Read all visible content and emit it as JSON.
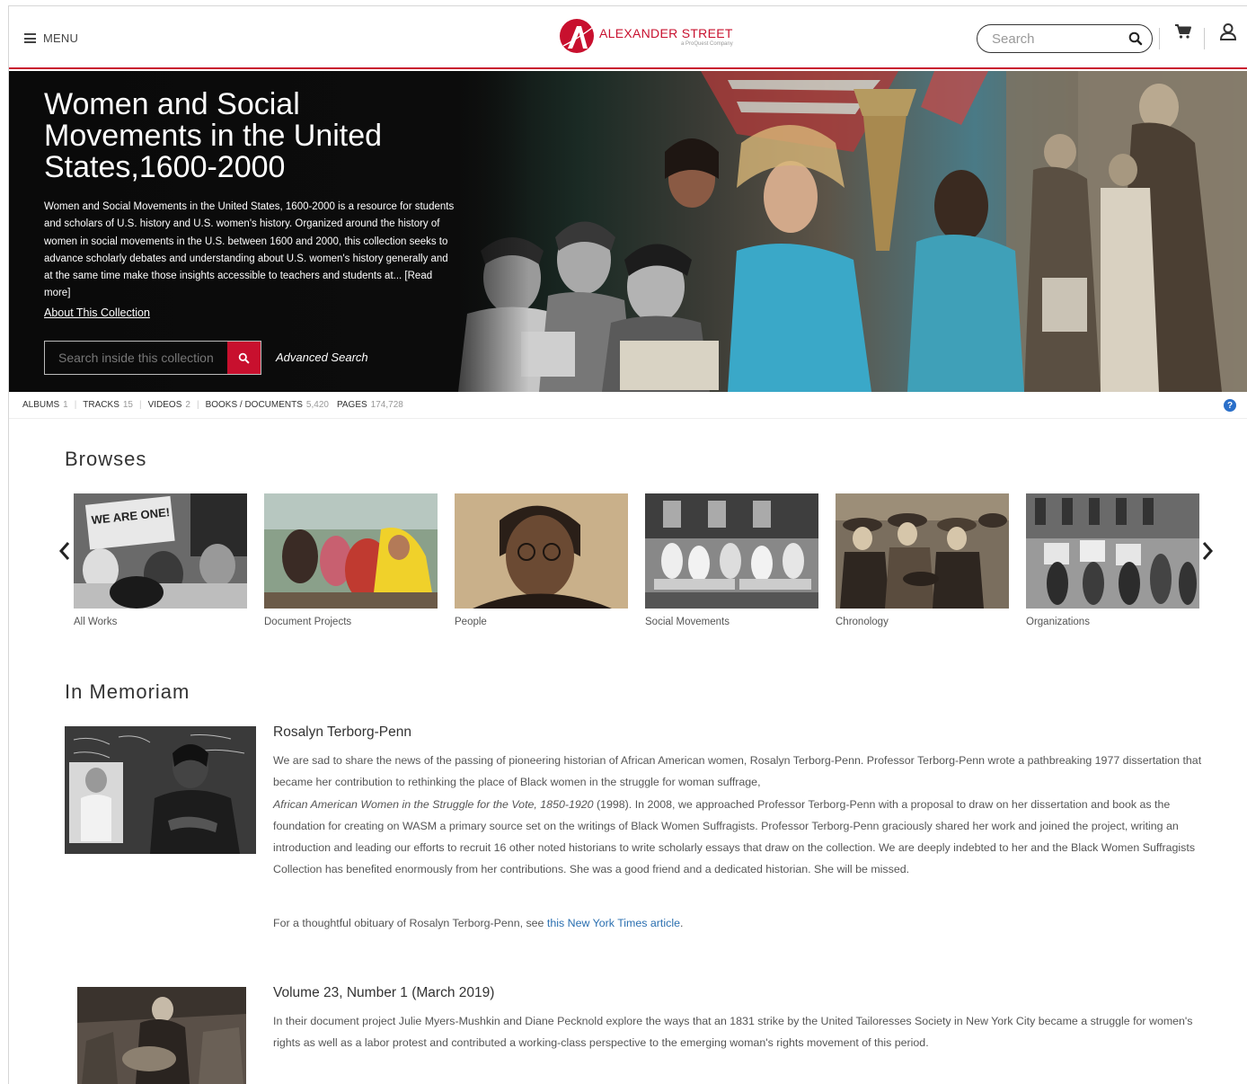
{
  "header": {
    "menu_label": "MENU",
    "logo_name": "ALEXANDER STREET",
    "logo_sub": "a ProQuest Company",
    "search_placeholder": "Search"
  },
  "hero": {
    "title": "Women and Social Movements in the United States,1600-2000",
    "description": "Women and Social Movements in the United States, 1600-2000 is a resource for students and scholars of U.S. history and U.S. women's history. Organized around the history of women in social movements in the U.S. between 1600 and 2000, this collection seeks to advance scholarly debates and understanding about U.S. women's history generally and at the same time make those insights accessible to teachers and students at... [Read more]",
    "about_link": "About This Collection",
    "collection_search_placeholder": "Search inside this collection",
    "advanced_search": "Advanced Search"
  },
  "stats": [
    {
      "label": "ALBUMS",
      "value": "1"
    },
    {
      "label": "TRACKS",
      "value": "15"
    },
    {
      "label": "VIDEOS",
      "value": "2"
    },
    {
      "label": "BOOKS / DOCUMENTS",
      "value": "5,420"
    },
    {
      "label": "PAGES",
      "value": "174,728"
    }
  ],
  "help_label": "?",
  "browses": {
    "title": "Browses",
    "items": [
      {
        "label": "All Works",
        "sign_text": "WE ARE ONE!"
      },
      {
        "label": "Document Projects"
      },
      {
        "label": "People"
      },
      {
        "label": "Social Movements"
      },
      {
        "label": "Chronology"
      },
      {
        "label": "Organizations"
      }
    ]
  },
  "memoriam": {
    "title": "In Memoriam",
    "entries": [
      {
        "title": "Rosalyn Terborg-Penn",
        "p1_a": "We are sad to share the news of the passing of pioneering historian of African American women, Rosalyn Terborg-Penn. Professor Terborg-Penn wrote a pathbreaking 1977 dissertation that became her contribution to rethinking the place of Black women in the struggle for woman suffrage,",
        "p1_italic": "African American Women in the Struggle for the Vote, 1850-1920",
        "p1_b": " (1998). In 2008, we approached Professor Terborg-Penn with a proposal to draw on her dissertation and book as the foundation for creating on WASM a primary source set on the writings of Black Women Suffragists. Professor Terborg-Penn graciously shared her work and joined the project, writing an introduction and leading our efforts to recruit 16 other noted historians to write scholarly essays that draw on the collection. We are deeply indebted to her and the Black Women Suffragists Collection has benefited enormously from her contributions. She was a good friend and a dedicated historian. She will be missed.",
        "p2_a": "For a thoughtful obituary of Rosalyn Terborg-Penn, see ",
        "p2_link": "this New York Times article",
        "p2_b": "."
      },
      {
        "title": "Volume 23, Number 1 (March 2019)",
        "p1": "In their document project Julie Myers-Mushkin and Diane Pecknold explore the ways that an 1831 strike by the United Tailoresses Society in New York City became a struggle for women's rights as well as a labor protest and contributed a working-class perspective to the emerging woman's rights movement of this period."
      }
    ]
  },
  "colors": {
    "brand_red": "#c8102e",
    "link_blue": "#2a6fb0",
    "help_blue": "#2a6fc9"
  }
}
